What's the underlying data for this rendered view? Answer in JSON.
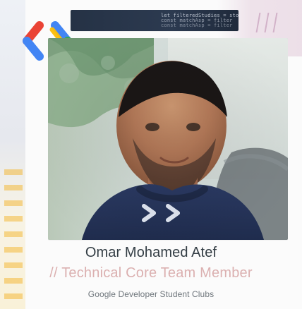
{
  "card": {
    "name": "Omar Mohamed Atef",
    "title": "// Technical Core Team Member",
    "organization": "Google Developer Student Clubs"
  },
  "background": {
    "code_lines": [
      "let filteredStudies = stor",
      "const matchAsp = filter",
      "const matchAsp = filter"
    ]
  },
  "logo": {
    "icon": "gdsc-brackets-logo-icon",
    "colors": [
      "#4285f4",
      "#ea4335",
      "#34a853",
      "#fbbc05"
    ]
  }
}
